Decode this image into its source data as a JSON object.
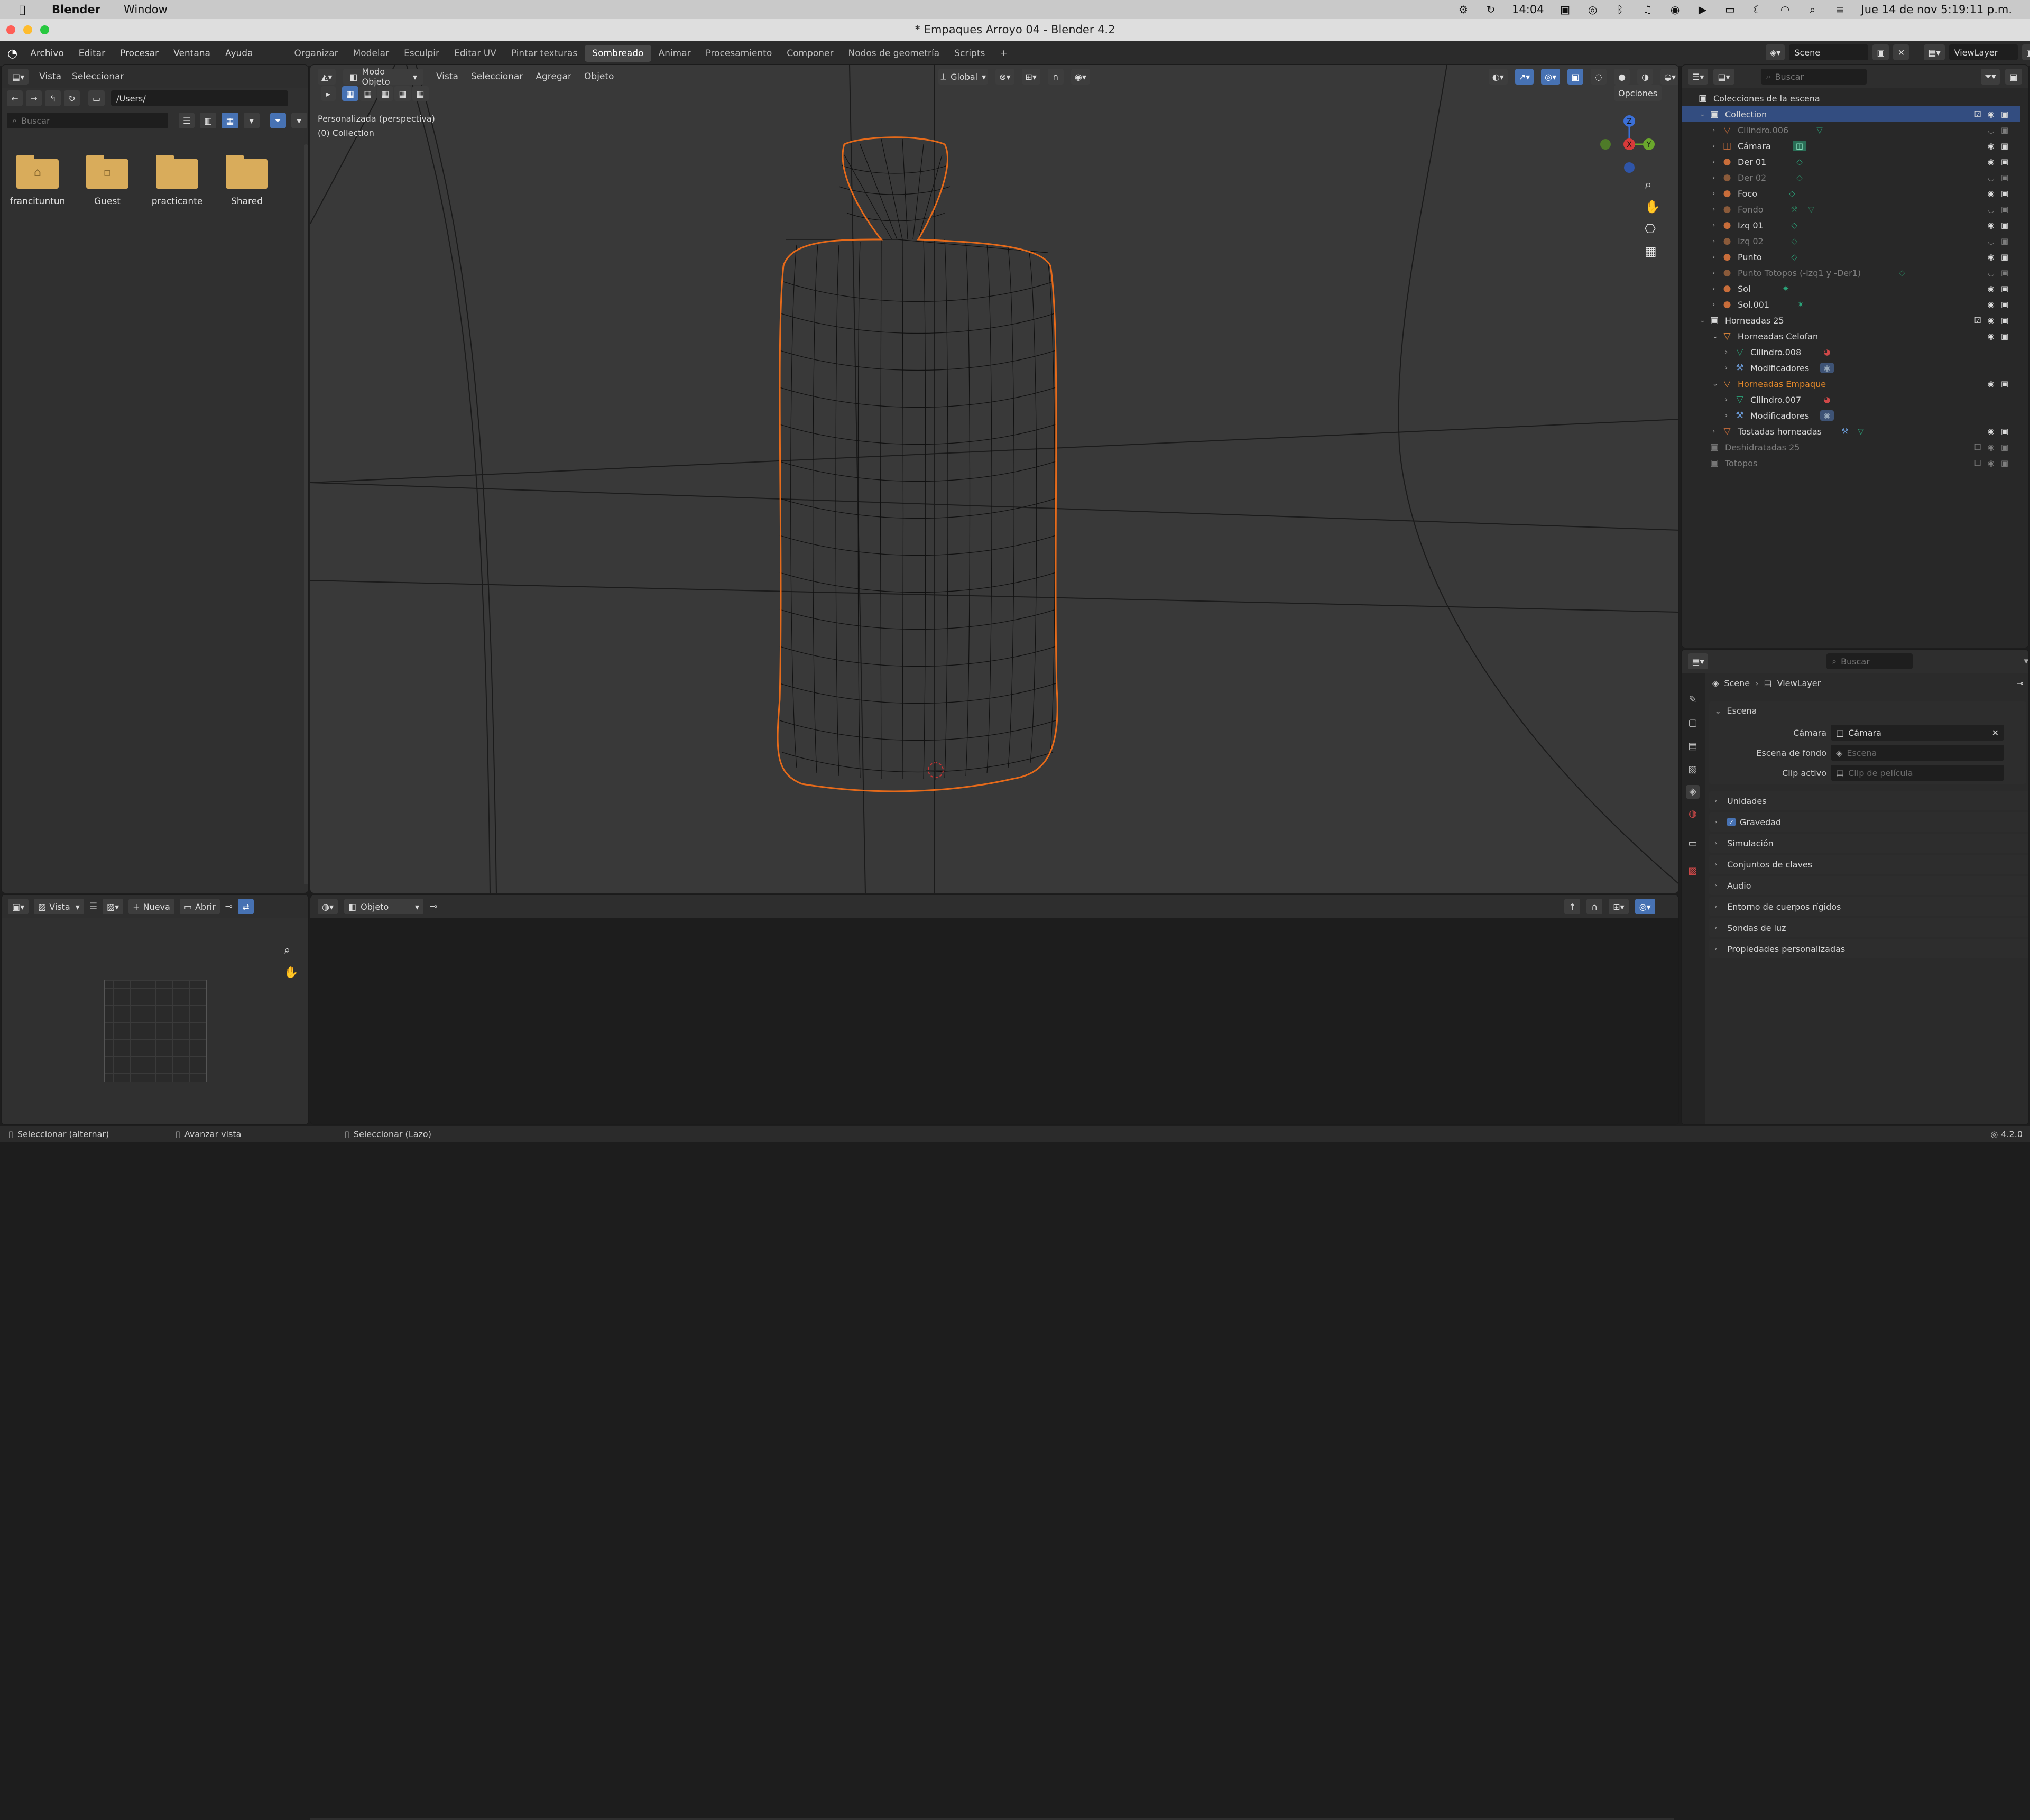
{
  "mac_menubar": {
    "app_name": "Blender",
    "menu_window": "Window",
    "time_short": "14:04",
    "datetime": "Jue 14 de nov  5:19:11 p.m."
  },
  "window": {
    "title": "* Empaques Arroyo 04 - Blender 4.2"
  },
  "menus": [
    "Archivo",
    "Editar",
    "Procesar",
    "Ventana",
    "Ayuda"
  ],
  "workspaces": [
    "Organizar",
    "Modelar",
    "Esculpir",
    "Editar UV",
    "Pintar texturas",
    "Sombreado",
    "Animar",
    "Procesamiento",
    "Componer",
    "Nodos de geometría",
    "Scripts"
  ],
  "active_workspace": "Sombreado",
  "file_browser": {
    "menu_vista": "Vista",
    "menu_seleccionar": "Seleccionar",
    "path": "/Users/",
    "search_placeholder": "Buscar",
    "folders": [
      "francituntun",
      "Guest",
      "practicante",
      "Shared"
    ]
  },
  "image_editor": {
    "view_label": "Vista",
    "new_label": "Nueva",
    "open_label": "Abrir"
  },
  "viewport": {
    "mode": "Modo Objeto",
    "menus": [
      "Vista",
      "Seleccionar",
      "Agregar",
      "Objeto"
    ],
    "transform_orientation": "Global",
    "options_label": "Opciones",
    "view_name": "Personalizada (perspectiva)",
    "collection_info": "(0) Collection",
    "gizmo": {
      "x": "X",
      "y": "Y",
      "z": "Z"
    }
  },
  "node_editor": {
    "object_label": "Objeto"
  },
  "outliner": {
    "scene_name": "Scene",
    "view_layer": "ViewLayer",
    "search_placeholder": "Buscar",
    "rows": [
      {
        "label": "Colecciones de la escena"
      },
      {
        "label": "Collection"
      },
      {
        "label": "Cilindro.006"
      },
      {
        "label": "Cámara"
      },
      {
        "label": "Der 01"
      },
      {
        "label": "Der 02"
      },
      {
        "label": "Foco"
      },
      {
        "label": "Fondo"
      },
      {
        "label": "Izq 01"
      },
      {
        "label": "Izq 02"
      },
      {
        "label": "Punto"
      },
      {
        "label": "Punto Totopos (-Izq1 y -Der1)"
      },
      {
        "label": "Sol"
      },
      {
        "label": "Sol.001"
      },
      {
        "label": "Horneadas 25"
      },
      {
        "label": "Horneadas Celofan"
      },
      {
        "label": "Cilindro.008"
      },
      {
        "label": "Modificadores"
      },
      {
        "label": "Horneadas Empaque"
      },
      {
        "label": "Cilindro.007"
      },
      {
        "label": "Modificadores"
      },
      {
        "label": "Tostadas horneadas"
      },
      {
        "label": "Deshidratadas 25"
      },
      {
        "label": "Totopos"
      }
    ]
  },
  "properties": {
    "search_placeholder": "Buscar",
    "breadcrumb_scene": "Scene",
    "breadcrumb_layer": "ViewLayer",
    "section_scene": "Escena",
    "camera_label": "Cámara",
    "camera_value": "Cámara",
    "background_label": "Escena de fondo",
    "background_placeholder": "Escena",
    "clip_label": "Clip activo",
    "clip_placeholder": "Clip de película",
    "panels": [
      "Unidades",
      "Gravedad",
      "Simulación",
      "Conjuntos de claves",
      "Audio",
      "Entorno de cuerpos rígidos",
      "Sondas de luz",
      "Propiedades personalizadas"
    ]
  },
  "statusbar": {
    "left": "Seleccionar (alternar)",
    "middle": "Avanzar vista",
    "right": "Seleccionar (Lazo)",
    "version": "4.2.0"
  },
  "colors": {
    "selection_orange": "#e66a1a",
    "selected_row": "#334d80",
    "accent_blue": "#4772b3"
  }
}
